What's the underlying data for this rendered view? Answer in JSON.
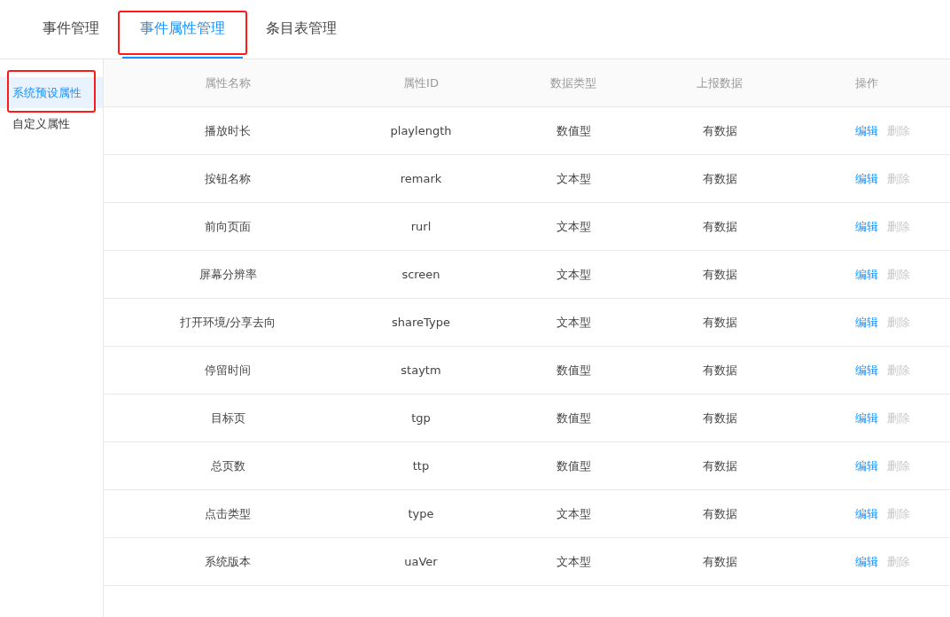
{
  "tabs": [
    {
      "label": "事件管理",
      "selected": false,
      "annotated": false
    },
    {
      "label": "事件属性管理",
      "selected": true,
      "annotated": true
    },
    {
      "label": "条目表管理",
      "selected": false,
      "annotated": false
    }
  ],
  "sidebar": {
    "items": [
      {
        "label": "系统预设属性",
        "selected": true,
        "annotated": true
      },
      {
        "label": "自定义属性",
        "selected": false,
        "annotated": false
      }
    ]
  },
  "table": {
    "columns": [
      "属性名称",
      "属性ID",
      "数据类型",
      "上报数据",
      "操作"
    ],
    "rows": [
      {
        "name": "播放时长",
        "id": "playlength",
        "type": "数值型",
        "data": "有数据",
        "actions": [
          {
            "label": "编辑",
            "disabled": false
          },
          {
            "label": "删除",
            "disabled": true
          }
        ]
      },
      {
        "name": "按钮名称",
        "id": "remark",
        "type": "文本型",
        "data": "有数据",
        "actions": [
          {
            "label": "编辑",
            "disabled": false
          },
          {
            "label": "删除",
            "disabled": true
          }
        ]
      },
      {
        "name": "前向页面",
        "id": "rurl",
        "type": "文本型",
        "data": "有数据",
        "actions": [
          {
            "label": "编辑",
            "disabled": false
          },
          {
            "label": "删除",
            "disabled": true
          }
        ]
      },
      {
        "name": "屏幕分辨率",
        "id": "screen",
        "type": "文本型",
        "data": "有数据",
        "actions": [
          {
            "label": "编辑",
            "disabled": false
          },
          {
            "label": "删除",
            "disabled": true
          }
        ]
      },
      {
        "name": "打开环境/分享去向",
        "id": "shareType",
        "type": "文本型",
        "data": "有数据",
        "actions": [
          {
            "label": "编辑",
            "disabled": false
          },
          {
            "label": "删除",
            "disabled": true
          }
        ]
      },
      {
        "name": "停留时间",
        "id": "staytm",
        "type": "数值型",
        "data": "有数据",
        "actions": [
          {
            "label": "编辑",
            "disabled": false
          },
          {
            "label": "删除",
            "disabled": true
          }
        ]
      },
      {
        "name": "目标页",
        "id": "tgp",
        "type": "数值型",
        "data": "有数据",
        "actions": [
          {
            "label": "编辑",
            "disabled": false
          },
          {
            "label": "删除",
            "disabled": true
          }
        ]
      },
      {
        "name": "总页数",
        "id": "ttp",
        "type": "数值型",
        "data": "有数据",
        "actions": [
          {
            "label": "编辑",
            "disabled": false
          },
          {
            "label": "删除",
            "disabled": true
          }
        ]
      },
      {
        "name": "点击类型",
        "id": "type",
        "type": "文本型",
        "data": "有数据",
        "actions": [
          {
            "label": "编辑",
            "disabled": false
          },
          {
            "label": "删除",
            "disabled": true
          }
        ]
      },
      {
        "name": "系统版本",
        "id": "uaVer",
        "type": "文本型",
        "data": "有数据",
        "actions": [
          {
            "label": "编辑",
            "disabled": false
          },
          {
            "label": "删除",
            "disabled": true
          }
        ]
      }
    ]
  }
}
